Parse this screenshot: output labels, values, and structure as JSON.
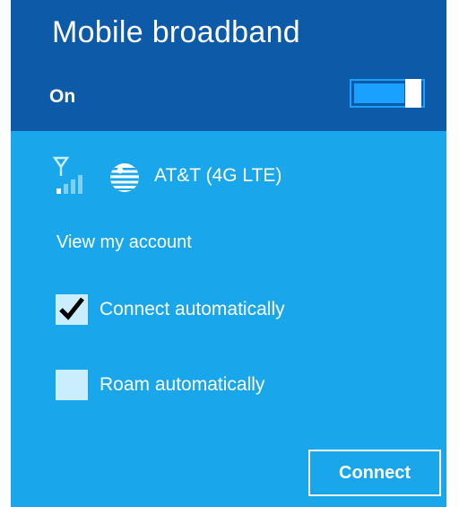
{
  "panel": {
    "title": "Mobile broadband",
    "toggle": {
      "label": "On",
      "state": "on"
    }
  },
  "network": {
    "name": "AT&T (4G LTE)",
    "signal_bars_filled": 1,
    "signal_bars_total": 4,
    "signal_icon": "cellular-signal-icon",
    "carrier_icon": "att-globe-icon"
  },
  "links": {
    "view_account": "View my account"
  },
  "options": [
    {
      "label": "Connect automatically",
      "checked": true
    },
    {
      "label": "Roam automatically",
      "checked": false
    }
  ],
  "actions": {
    "connect": "Connect"
  },
  "colors": {
    "header_bg": "#0d5aa8",
    "body_bg": "#19a6ea",
    "toggle_accent": "#1aa1ff",
    "checkbox_bg": "#cbeeff",
    "text": "#ffffff"
  }
}
